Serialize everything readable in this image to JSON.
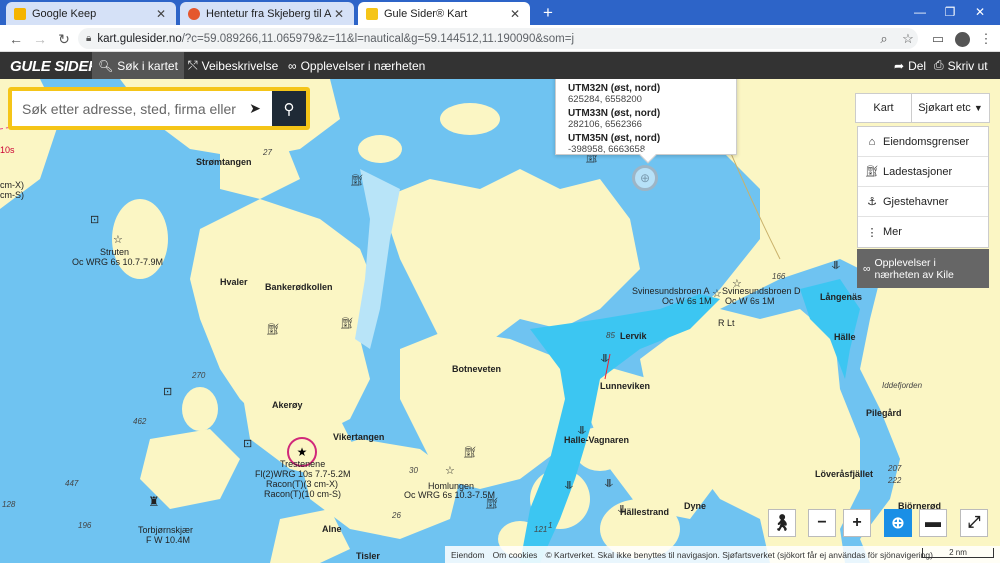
{
  "browser": {
    "tabs": [
      {
        "title": "Google Keep",
        "favicon_color": "#f5b400",
        "active": false
      },
      {
        "title": "Hentetur fra Skjeberg til Arendal",
        "favicon_color": "#e4572e",
        "active": false
      },
      {
        "title": "Gule Sider® Kart",
        "favicon_color": "#f5c518",
        "active": true
      }
    ],
    "new_tab_label": "+",
    "url_host": "kart.gulesider.no",
    "url_rest": "/?c=59.089266,11.065979&z=11&l=nautical&g=59.144512,11.190090&som=j",
    "tab_close": "✕",
    "win_min": "—",
    "win_max": "❐",
    "win_close": "✕"
  },
  "sitenav": {
    "logo": "GULE SIDER",
    "items": [
      {
        "label": "Søk i kartet",
        "icon": "search-icon",
        "selected": true
      },
      {
        "label": "Veibeskrivelse",
        "icon": "route-icon",
        "selected": false
      },
      {
        "label": "Opplevelser i nærheten",
        "icon": "binoculars-icon",
        "selected": false
      }
    ],
    "share_label": "Del",
    "print_label": "Skriv ut"
  },
  "search": {
    "placeholder": "Søk etter adresse, sted, firma eller tjeneste"
  },
  "coords_popup": {
    "entries": [
      {
        "label": "UTM32N (øst, nord)",
        "value": "625284, 6558200"
      },
      {
        "label": "UTM33N (øst, nord)",
        "value": "282106, 6562366"
      },
      {
        "label": "UTM35N (øst, nord)",
        "value": "-398958, 6663658"
      }
    ]
  },
  "map_type": {
    "options": [
      "Kart",
      "Sjøkart etc"
    ],
    "selected": "Sjøkart etc"
  },
  "layers": [
    {
      "label": "Eiendomsgrenser",
      "icon": "property-icon"
    },
    {
      "label": "Ladestasjoner",
      "icon": "charger-icon"
    },
    {
      "label": "Gjestehavner",
      "icon": "harbor-icon"
    },
    {
      "label": "Mer",
      "icon": "more-icon"
    }
  ],
  "experiences_button": "Opplevelser i nærheten av Kile",
  "map_labels": [
    "Strømtangen",
    "Struten",
    "Oc WRG 6s 10.7-7.9M",
    "Hvaler",
    "Bankerødkollen",
    "Botneveten",
    "Akerøy",
    "Vikertangen",
    "Trestenene",
    "Fl(2)WRG 10s 7.7-5.2M",
    "Racon(T)(3 cm-X)",
    "Racon(T)(10 cm-S)",
    "Homlungen",
    "Oc WRG 6s 10.3-7.5M",
    "Torbjørnskjær",
    "F W 10.4M",
    "Alne",
    "Tisler",
    "Lervik",
    "Lunneviken",
    "Halle-Vagnaren",
    "Hällestrand",
    "Dyne",
    "Svinesundsbroen A",
    "Oc W 6s 1M",
    "Svinesundsbroen D",
    "R Lt",
    "Långenäs",
    "Hälle",
    "Iddefjorden",
    "Pilegård",
    "Löveråsfjället",
    "Björnerød",
    "10s",
    "cm-X)",
    "cm-S)"
  ],
  "depth_numbers": [
    "27",
    "270",
    "462",
    "447",
    "196",
    "128",
    "30",
    "26",
    "85",
    "166",
    "207",
    "222",
    "121",
    "1"
  ],
  "map_controls": {
    "zoom_out": "−",
    "zoom_in": "+"
  },
  "footer": {
    "items": [
      "Eiendom",
      "Om cookies",
      "© Kartverket. Skal ikke benyttes til navigasjon. Sjøfartsverket (sjökort får ej användas för sjönavigering)"
    ],
    "scale_label": "2 nm"
  },
  "colors": {
    "water": "#6fc3f1",
    "land": "#fbf6c4",
    "shallow": "#3cc6f2",
    "brand_yellow": "#f5c518",
    "nav_bg": "#333333"
  }
}
